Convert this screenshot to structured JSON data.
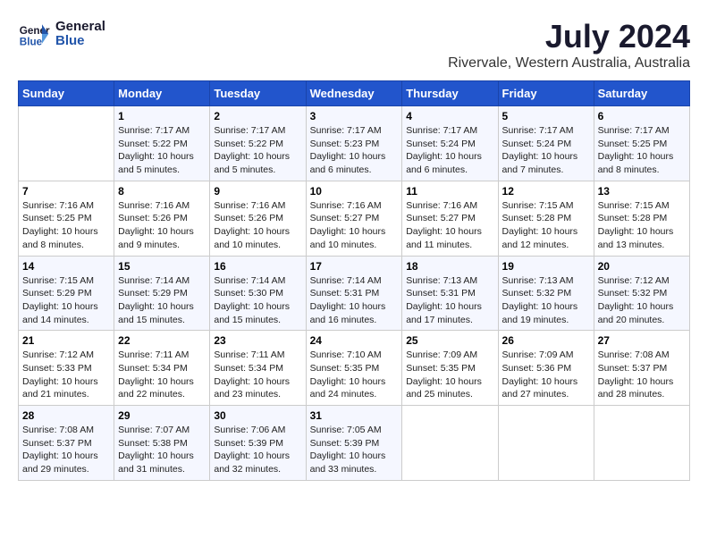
{
  "header": {
    "logo_line1": "General",
    "logo_line2": "Blue",
    "month_title": "July 2024",
    "location": "Rivervale, Western Australia, Australia"
  },
  "weekdays": [
    "Sunday",
    "Monday",
    "Tuesday",
    "Wednesday",
    "Thursday",
    "Friday",
    "Saturday"
  ],
  "weeks": [
    [
      {
        "day": "",
        "sunrise": "",
        "sunset": "",
        "daylight": ""
      },
      {
        "day": "1",
        "sunrise": "Sunrise: 7:17 AM",
        "sunset": "Sunset: 5:22 PM",
        "daylight": "Daylight: 10 hours and 5 minutes."
      },
      {
        "day": "2",
        "sunrise": "Sunrise: 7:17 AM",
        "sunset": "Sunset: 5:22 PM",
        "daylight": "Daylight: 10 hours and 5 minutes."
      },
      {
        "day": "3",
        "sunrise": "Sunrise: 7:17 AM",
        "sunset": "Sunset: 5:23 PM",
        "daylight": "Daylight: 10 hours and 6 minutes."
      },
      {
        "day": "4",
        "sunrise": "Sunrise: 7:17 AM",
        "sunset": "Sunset: 5:24 PM",
        "daylight": "Daylight: 10 hours and 6 minutes."
      },
      {
        "day": "5",
        "sunrise": "Sunrise: 7:17 AM",
        "sunset": "Sunset: 5:24 PM",
        "daylight": "Daylight: 10 hours and 7 minutes."
      },
      {
        "day": "6",
        "sunrise": "Sunrise: 7:17 AM",
        "sunset": "Sunset: 5:25 PM",
        "daylight": "Daylight: 10 hours and 8 minutes."
      }
    ],
    [
      {
        "day": "7",
        "sunrise": "Sunrise: 7:16 AM",
        "sunset": "Sunset: 5:25 PM",
        "daylight": "Daylight: 10 hours and 8 minutes."
      },
      {
        "day": "8",
        "sunrise": "Sunrise: 7:16 AM",
        "sunset": "Sunset: 5:26 PM",
        "daylight": "Daylight: 10 hours and 9 minutes."
      },
      {
        "day": "9",
        "sunrise": "Sunrise: 7:16 AM",
        "sunset": "Sunset: 5:26 PM",
        "daylight": "Daylight: 10 hours and 10 minutes."
      },
      {
        "day": "10",
        "sunrise": "Sunrise: 7:16 AM",
        "sunset": "Sunset: 5:27 PM",
        "daylight": "Daylight: 10 hours and 10 minutes."
      },
      {
        "day": "11",
        "sunrise": "Sunrise: 7:16 AM",
        "sunset": "Sunset: 5:27 PM",
        "daylight": "Daylight: 10 hours and 11 minutes."
      },
      {
        "day": "12",
        "sunrise": "Sunrise: 7:15 AM",
        "sunset": "Sunset: 5:28 PM",
        "daylight": "Daylight: 10 hours and 12 minutes."
      },
      {
        "day": "13",
        "sunrise": "Sunrise: 7:15 AM",
        "sunset": "Sunset: 5:28 PM",
        "daylight": "Daylight: 10 hours and 13 minutes."
      }
    ],
    [
      {
        "day": "14",
        "sunrise": "Sunrise: 7:15 AM",
        "sunset": "Sunset: 5:29 PM",
        "daylight": "Daylight: 10 hours and 14 minutes."
      },
      {
        "day": "15",
        "sunrise": "Sunrise: 7:14 AM",
        "sunset": "Sunset: 5:29 PM",
        "daylight": "Daylight: 10 hours and 15 minutes."
      },
      {
        "day": "16",
        "sunrise": "Sunrise: 7:14 AM",
        "sunset": "Sunset: 5:30 PM",
        "daylight": "Daylight: 10 hours and 15 minutes."
      },
      {
        "day": "17",
        "sunrise": "Sunrise: 7:14 AM",
        "sunset": "Sunset: 5:31 PM",
        "daylight": "Daylight: 10 hours and 16 minutes."
      },
      {
        "day": "18",
        "sunrise": "Sunrise: 7:13 AM",
        "sunset": "Sunset: 5:31 PM",
        "daylight": "Daylight: 10 hours and 17 minutes."
      },
      {
        "day": "19",
        "sunrise": "Sunrise: 7:13 AM",
        "sunset": "Sunset: 5:32 PM",
        "daylight": "Daylight: 10 hours and 19 minutes."
      },
      {
        "day": "20",
        "sunrise": "Sunrise: 7:12 AM",
        "sunset": "Sunset: 5:32 PM",
        "daylight": "Daylight: 10 hours and 20 minutes."
      }
    ],
    [
      {
        "day": "21",
        "sunrise": "Sunrise: 7:12 AM",
        "sunset": "Sunset: 5:33 PM",
        "daylight": "Daylight: 10 hours and 21 minutes."
      },
      {
        "day": "22",
        "sunrise": "Sunrise: 7:11 AM",
        "sunset": "Sunset: 5:34 PM",
        "daylight": "Daylight: 10 hours and 22 minutes."
      },
      {
        "day": "23",
        "sunrise": "Sunrise: 7:11 AM",
        "sunset": "Sunset: 5:34 PM",
        "daylight": "Daylight: 10 hours and 23 minutes."
      },
      {
        "day": "24",
        "sunrise": "Sunrise: 7:10 AM",
        "sunset": "Sunset: 5:35 PM",
        "daylight": "Daylight: 10 hours and 24 minutes."
      },
      {
        "day": "25",
        "sunrise": "Sunrise: 7:09 AM",
        "sunset": "Sunset: 5:35 PM",
        "daylight": "Daylight: 10 hours and 25 minutes."
      },
      {
        "day": "26",
        "sunrise": "Sunrise: 7:09 AM",
        "sunset": "Sunset: 5:36 PM",
        "daylight": "Daylight: 10 hours and 27 minutes."
      },
      {
        "day": "27",
        "sunrise": "Sunrise: 7:08 AM",
        "sunset": "Sunset: 5:37 PM",
        "daylight": "Daylight: 10 hours and 28 minutes."
      }
    ],
    [
      {
        "day": "28",
        "sunrise": "Sunrise: 7:08 AM",
        "sunset": "Sunset: 5:37 PM",
        "daylight": "Daylight: 10 hours and 29 minutes."
      },
      {
        "day": "29",
        "sunrise": "Sunrise: 7:07 AM",
        "sunset": "Sunset: 5:38 PM",
        "daylight": "Daylight: 10 hours and 31 minutes."
      },
      {
        "day": "30",
        "sunrise": "Sunrise: 7:06 AM",
        "sunset": "Sunset: 5:39 PM",
        "daylight": "Daylight: 10 hours and 32 minutes."
      },
      {
        "day": "31",
        "sunrise": "Sunrise: 7:05 AM",
        "sunset": "Sunset: 5:39 PM",
        "daylight": "Daylight: 10 hours and 33 minutes."
      },
      {
        "day": "",
        "sunrise": "",
        "sunset": "",
        "daylight": ""
      },
      {
        "day": "",
        "sunrise": "",
        "sunset": "",
        "daylight": ""
      },
      {
        "day": "",
        "sunrise": "",
        "sunset": "",
        "daylight": ""
      }
    ]
  ]
}
